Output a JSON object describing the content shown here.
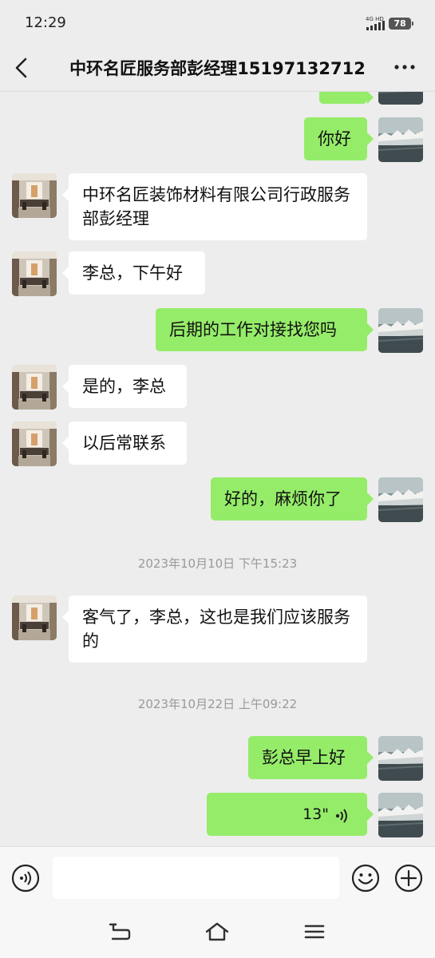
{
  "status_bar": {
    "time": "12:29",
    "network": "4G HD",
    "battery": "78"
  },
  "header": {
    "title": "中环名匠服务部彭经理15197132712"
  },
  "messages": [
    {
      "side": "out",
      "text": "你好"
    },
    {
      "side": "in",
      "text": "中环名匠装饰材料有限公司行政服务部彭经理"
    },
    {
      "side": "in",
      "text": "李总，下午好"
    },
    {
      "side": "out",
      "text": "后期的工作对接找您吗"
    },
    {
      "side": "in",
      "text": "是的，李总"
    },
    {
      "side": "in",
      "text": "以后常联系"
    },
    {
      "side": "out",
      "text": "好的，麻烦你了"
    },
    {
      "type": "timestamp",
      "text": "2023年10月10日 下午15:23"
    },
    {
      "side": "in",
      "text": "客气了，李总，这也是我们应该服务的"
    },
    {
      "type": "timestamp",
      "text": "2023年10月22日 上午09:22"
    },
    {
      "side": "out",
      "text": "彭总早上好"
    },
    {
      "side": "out",
      "type": "voice",
      "duration": "13\""
    }
  ],
  "colors": {
    "outgoing_bubble": "#95ec69",
    "incoming_bubble": "#ffffff",
    "background": "#ededed"
  },
  "icons": [
    "back-icon",
    "more-icon",
    "voice-mode-icon",
    "emoji-icon",
    "plus-icon",
    "voice-wave-icon",
    "nav-back-icon",
    "nav-home-icon",
    "nav-menu-icon"
  ]
}
